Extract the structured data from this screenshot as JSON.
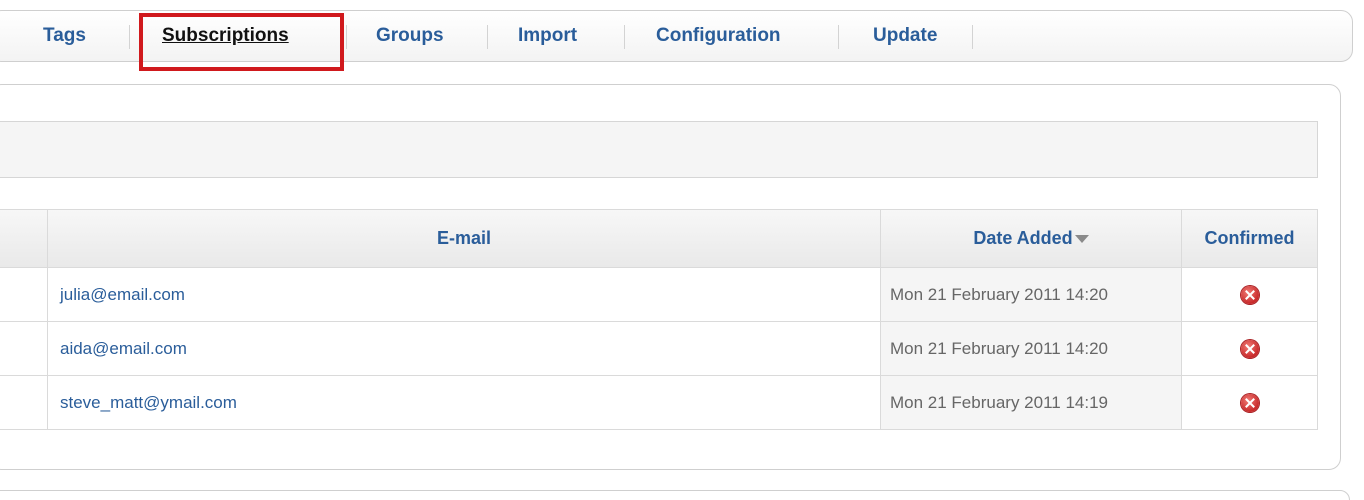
{
  "tabs": [
    {
      "label": "Tags",
      "active": false
    },
    {
      "label": "Subscriptions",
      "active": true
    },
    {
      "label": "Groups",
      "active": false
    },
    {
      "label": "Import",
      "active": false
    },
    {
      "label": "Configuration",
      "active": false
    },
    {
      "label": "Update",
      "active": false
    }
  ],
  "table": {
    "headers": {
      "email": "E-mail",
      "date_added": "Date Added",
      "confirmed": "Confirmed"
    },
    "sort_icon": "sort-desc-icon",
    "rows": [
      {
        "email": "julia@email.com",
        "date_added": "Mon 21 February 2011 14:20",
        "confirmed_icon": "unconfirmed-x-icon"
      },
      {
        "email": "aida@email.com",
        "date_added": "Mon 21 February 2011 14:20",
        "confirmed_icon": "unconfirmed-x-icon"
      },
      {
        "email": "steve_matt@ymail.com",
        "date_added": "Mon 21 February 2011 14:19",
        "confirmed_icon": "unconfirmed-x-icon"
      }
    ]
  },
  "colors": {
    "link": "#2a5d9a",
    "highlight": "#d0191d",
    "unconfirmed": "#c8292a"
  }
}
